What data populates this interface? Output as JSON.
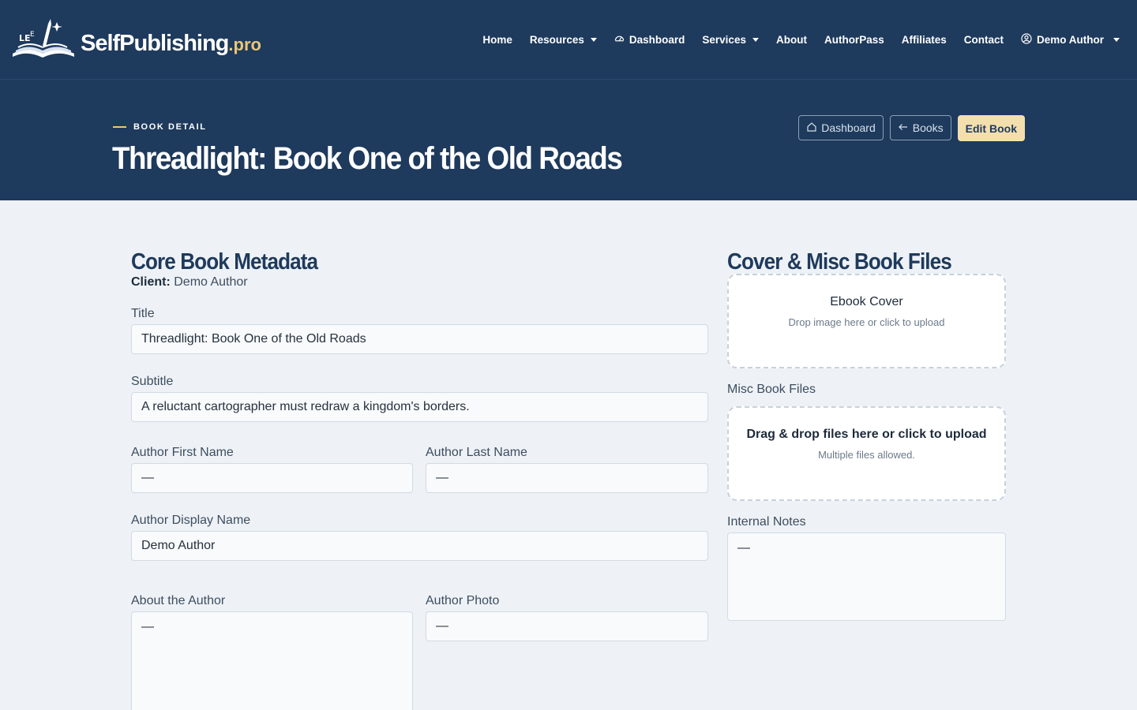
{
  "brand": {
    "name": "SelfPublishing",
    "suffix": ".pro"
  },
  "nav": {
    "items": [
      {
        "label": "Home",
        "name": "nav-home",
        "icon": null,
        "caret": false
      },
      {
        "label": "Resources",
        "name": "nav-resources",
        "icon": null,
        "caret": true
      },
      {
        "label": "Dashboard",
        "name": "nav-dashboard",
        "icon": "speedometer-icon",
        "caret": false
      },
      {
        "label": "Services",
        "name": "nav-services",
        "icon": null,
        "caret": true
      },
      {
        "label": "About",
        "name": "nav-about",
        "icon": null,
        "caret": false
      },
      {
        "label": "AuthorPass",
        "name": "nav-authorpass",
        "icon": null,
        "caret": false
      },
      {
        "label": "Affiliates",
        "name": "nav-affiliates",
        "icon": null,
        "caret": false
      },
      {
        "label": "Contact",
        "name": "nav-contact",
        "icon": null,
        "caret": false
      }
    ],
    "user": {
      "label": "Demo Author",
      "icon": "user-circle-icon"
    }
  },
  "hero": {
    "eyebrow": "BOOK DETAIL",
    "title": "Threadlight: Book One of the Old Roads",
    "actions": {
      "dashboard_label": "Dashboard",
      "books_label": "Books",
      "edit_label": "Edit Book"
    }
  },
  "core": {
    "section_title": "Core Book Metadata",
    "client_label": "Client:",
    "client_value": "Demo Author",
    "fields": {
      "title": {
        "label": "Title",
        "value": "Threadlight: Book One of the Old Roads"
      },
      "subtitle": {
        "label": "Subtitle",
        "value": "A reluctant cartographer must redraw a kingdom's borders."
      },
      "first_name": {
        "label": "Author First Name",
        "value": "—"
      },
      "last_name": {
        "label": "Author Last Name",
        "value": "—"
      },
      "display_name": {
        "label": "Author Display Name",
        "value": "Demo Author"
      },
      "about": {
        "label": "About the Author",
        "value": "—"
      },
      "photo": {
        "label": "Author Photo",
        "value": "—"
      }
    }
  },
  "files": {
    "section_title": "Cover & Misc Book Files",
    "ebook_cover": {
      "title": "Ebook Cover",
      "hint": "Drop image here or click to upload"
    },
    "misc_label": "Misc Book Files",
    "misc_drop": {
      "title": "Drag & drop files here or click to upload",
      "hint": "Multiple files allowed."
    },
    "notes": {
      "label": "Internal Notes",
      "value": "—"
    }
  },
  "colors": {
    "navy": "#1e3a5c",
    "gold": "#e9c77a",
    "gold_button": "#f3dfae",
    "page_bg": "#eef2f7"
  }
}
